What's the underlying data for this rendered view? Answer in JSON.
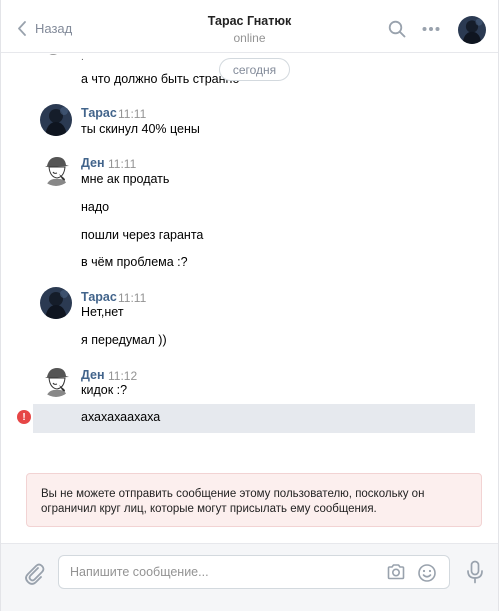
{
  "header": {
    "back_label": "Назад",
    "title": "Тарас Гнатюк",
    "status": "online"
  },
  "history": {
    "date_separator": "сегодня",
    "top_message": "а что должно быть странно",
    "groups": [
      {
        "author": "Тарас",
        "time": "11:11",
        "messages": [
          "ты скинул 40% цены"
        ]
      },
      {
        "author": "Ден",
        "time": "11:11",
        "messages": [
          "мне ак продать",
          "надо",
          "пошли через гаранта",
          "в чём проблема :?"
        ]
      },
      {
        "author": "Тарас",
        "time": "11:11",
        "messages": [
          "Нет,нет",
          "я передумал ))"
        ]
      },
      {
        "author": "Ден",
        "time": "11:12",
        "messages": [
          "кидок :?"
        ]
      }
    ],
    "failed_message": "ахахахаахаха",
    "error_icon_glyph": "!"
  },
  "notice": {
    "text": "Вы не можете отправить сообщение этому пользователю, поскольку он ограничил круг лиц, которые могут присылать ему сообщения."
  },
  "composer": {
    "placeholder": "Напишите сообщение...",
    "value": ""
  },
  "colors": {
    "link": "#42648b",
    "muted": "#939393",
    "error": "#e64646",
    "notice_bg": "#fcefee"
  },
  "icons": [
    "chevron-left-icon",
    "search-icon",
    "more-icon",
    "paperclip-icon",
    "camera-icon",
    "smile-icon",
    "microphone-icon",
    "error-icon"
  ]
}
